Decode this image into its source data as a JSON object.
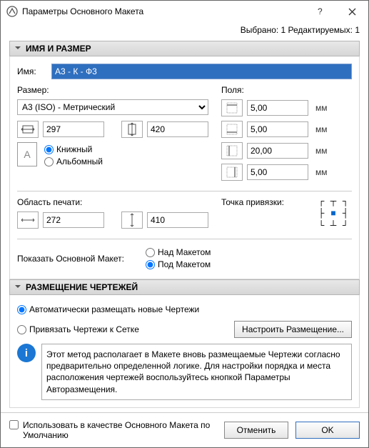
{
  "title": "Параметры Основного Макета",
  "selection_info": "Выбрано: 1 Редактируемых: 1",
  "sections": {
    "name_size": "ИМЯ И РАЗМЕР",
    "placement": "РАЗМЕЩЕНИЕ ЧЕРТЕЖЕЙ"
  },
  "labels": {
    "name": "Имя:",
    "size": "Размер:",
    "margins": "Поля:",
    "print_area": "Область печати:",
    "anchor": "Точка привязки:",
    "show_master": "Показать Основной Макет:",
    "above": "Над Макетом",
    "below": "Под Макетом",
    "portrait": "Книжный",
    "landscape": "Альбомный",
    "auto_place": "Автоматически размещать новые Чертежи",
    "snap_grid": "Привязать Чертежи к Сетке",
    "configure": "Настроить Размещение...",
    "use_default": "Использовать в качестве Основного Макета по Умолчанию",
    "cancel": "Отменить",
    "ok": "OK",
    "mm": "мм"
  },
  "values": {
    "name": "А3 - К - Ф3",
    "size_preset": "A3 (ISO) - Метрический",
    "width": "297",
    "height": "420",
    "margin_top": "5,00",
    "margin_bottom": "5,00",
    "margin_left": "20,00",
    "margin_right": "5,00",
    "print_w": "272",
    "print_h": "410",
    "orientation": "portrait",
    "show_master": "below",
    "placement_mode": "auto",
    "use_default": false
  },
  "info_text": "Этот метод располагает в Макете вновь размещаемые Чертежи согласно предварительно определенной логике. Для настройки порядка и места расположения чертежей воспользуйтесь кнопкой Параметры Авторазмещения."
}
